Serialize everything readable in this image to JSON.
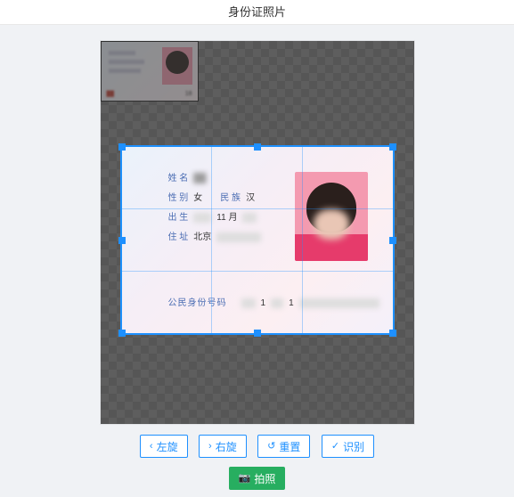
{
  "header": {
    "title": "身份证照片"
  },
  "card": {
    "labels": {
      "name": "姓 名",
      "sex": "性 别",
      "ethnic": "民 族",
      "birth": "出 生",
      "address": "住 址",
      "idnum": "公民身份号码"
    },
    "values": {
      "name_blur": "██",
      "sex": "女",
      "ethnic": "汉",
      "birth_mid": "11 月",
      "address_prefix": "北京",
      "id_prefix": "1",
      "id_frag": "1"
    },
    "thumb": {
      "num_suffix": "18"
    }
  },
  "buttons": {
    "rotate_left": "左旋",
    "rotate_right": "右旋",
    "reset": "重置",
    "recognize": "识别",
    "capture": "拍照"
  }
}
